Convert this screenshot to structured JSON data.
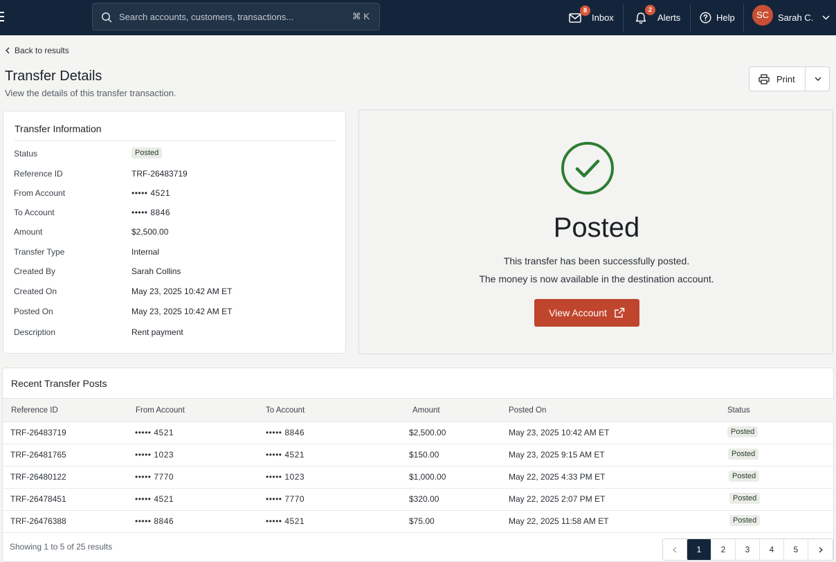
{
  "topbar": {
    "search_placeholder": "Search accounts, customers, transactions...",
    "search_shortcut": "⌘ K",
    "inbox_label": "Inbox",
    "inbox_count": "8",
    "alerts_label": "Alerts",
    "alerts_count": "2",
    "help_label": "Help",
    "user_initials": "SC",
    "user_name": "Sarah C."
  },
  "header": {
    "back_label": "Back to results",
    "title": "Transfer Details",
    "subtitle": "View the details of this transfer transaction.",
    "print_label": "Print"
  },
  "info": {
    "title": "Transfer Information",
    "rows": [
      {
        "label": "Status",
        "value": "Posted"
      },
      {
        "label": "Reference ID",
        "value": "TRF-26483719"
      },
      {
        "label": "From Account",
        "value": "••••• 4521"
      },
      {
        "label": "To Account",
        "value": "••••• 8846"
      },
      {
        "label": "Amount",
        "value": "$2,500.00"
      },
      {
        "label": "Transfer Type",
        "value": "Internal"
      },
      {
        "label": "Created By",
        "value": "Sarah Collins"
      },
      {
        "label": "Created On",
        "value": "May 23, 2025 10:42 AM ET"
      },
      {
        "label": "Posted On",
        "value": "May 23, 2025 10:42 AM ET"
      },
      {
        "label": "Description",
        "value": "Rent payment"
      }
    ]
  },
  "status_panel": {
    "status": "Posted",
    "line1": "This transfer has been successfully posted.",
    "line2": "The money is now available in the destination account.",
    "button_label": "View Account",
    "check_color": "#2e7d32",
    "button_color": "#c0452d"
  },
  "recent": {
    "title": "Recent Transfer Posts",
    "columns": [
      "Reference ID",
      "From Account",
      "To Account",
      "Amount",
      "Posted On",
      "Status"
    ],
    "rows": [
      {
        "ref": "TRF-26483719",
        "from": "••••• 4521",
        "to": "••••• 8846",
        "amount": "$2,500.00",
        "posted": "May 23, 2025 10:42 AM ET",
        "status": "Posted"
      },
      {
        "ref": "TRF-26481765",
        "from": "••••• 1023",
        "to": "••••• 4521",
        "amount": "$150.00",
        "posted": "May 23, 2025 9:15 AM ET",
        "status": "Posted"
      },
      {
        "ref": "TRF-26480122",
        "from": "••••• 7770",
        "to": "••••• 1023",
        "amount": "$1,000.00",
        "posted": "May 22, 2025 4:33 PM ET",
        "status": "Posted"
      },
      {
        "ref": "TRF-26478451",
        "from": "••••• 4521",
        "to": "••••• 7770",
        "amount": "$320.00",
        "posted": "May 22, 2025 2:07 PM ET",
        "status": "Posted"
      },
      {
        "ref": "TRF-26476388",
        "from": "••••• 8846",
        "to": "••••• 4521",
        "amount": "$75.00",
        "posted": "May 22, 2025 11:58 AM ET",
        "status": "Posted"
      }
    ],
    "showing_text": "Showing 1 to 5 of 25 results",
    "pages": [
      "1",
      "2",
      "3",
      "4",
      "5"
    ],
    "current_page": "1"
  }
}
